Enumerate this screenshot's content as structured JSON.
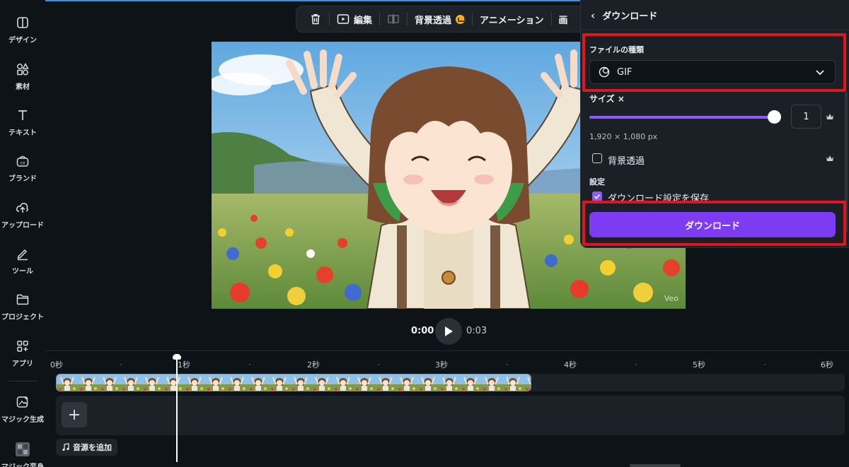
{
  "rail": {
    "items": [
      {
        "label": "デザイン",
        "icon": "design-icon"
      },
      {
        "label": "素材",
        "icon": "elements-icon"
      },
      {
        "label": "テキスト",
        "icon": "text-icon"
      },
      {
        "label": "ブランド",
        "icon": "brand-icon"
      },
      {
        "label": "アップロード",
        "icon": "upload-icon"
      },
      {
        "label": "ツール",
        "icon": "tools-icon"
      },
      {
        "label": "プロジェクト",
        "icon": "folder-icon"
      },
      {
        "label": "アプリ",
        "icon": "apps-icon"
      },
      {
        "label": "マジック生成",
        "icon": "magic-generate-icon"
      },
      {
        "label": "マジック変身",
        "icon": "magic-morph-icon"
      }
    ]
  },
  "toolbar": {
    "edit_label": "編集",
    "bg_remove_label": "背景透過",
    "animation_label": "アニメーション",
    "more_label": "画"
  },
  "canvas": {
    "watermark": "Veo"
  },
  "playback": {
    "current": "0:00",
    "total": "0:03"
  },
  "timeline": {
    "ticks": [
      "0秒",
      "1秒",
      "2秒",
      "3秒",
      "4秒",
      "5秒",
      "6秒"
    ],
    "add_audio_label": "音源を追加",
    "add_symbol": "+"
  },
  "download_panel": {
    "title": "ダウンロード",
    "file_type_label": "ファイルの種類",
    "file_type_value": "GIF",
    "size_label": "サイズ ×",
    "size_value": "1",
    "size_slider_fraction": 1.0,
    "dimensions": "1,920 × 1,080 px",
    "transparent_bg_label": "背景透過",
    "transparent_bg_checked": false,
    "settings_label": "設定",
    "save_settings_label": "ダウンロード設定を保存",
    "save_settings_checked": true,
    "download_button": "ダウンロード"
  },
  "colors": {
    "accent": "#7d3cf2",
    "slider": "#8b5cf6",
    "highlight": "#e0161e",
    "premium_crown": "#f2b01e"
  }
}
